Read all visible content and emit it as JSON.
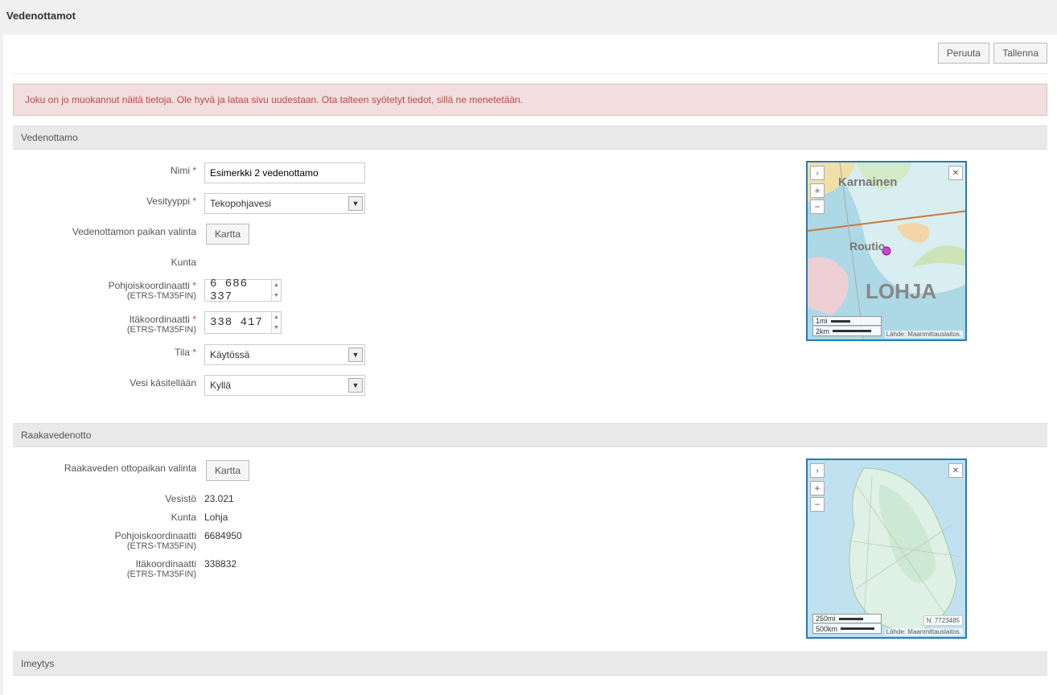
{
  "page": {
    "title": "Vedenottamot"
  },
  "actions": {
    "cancel": "Peruuta",
    "save": "Tallenna"
  },
  "alert": {
    "message": "Joku on jo muokannut näitä tietoja. Ole hyvä ja lataa sivu uudestaan. Ota talteen syötetyt tiedot, sillä ne menetetään."
  },
  "sections": {
    "vedenottamo": {
      "title": "Vedenottamo",
      "labels": {
        "nimi": "Nimi",
        "vesityyppi": "Vesityyppi",
        "paikan_valinta": "Vedenottamon paikan valinta",
        "kunta": "Kunta",
        "pohjois_line1": "Pohjoiskoordinaatti",
        "pohjois_line2": "(ETRS-TM35FIN)",
        "ita_line1": "Itäkoordinaatti",
        "ita_line2": "(ETRS-TM35FIN)",
        "tila": "Tila",
        "kasitellaan": "Vesi käsitellään"
      },
      "values": {
        "nimi": "Esimerkki 2 vedenottamo",
        "vesityyppi": "Tekopohjavesi",
        "kartta_btn": "Kartta",
        "kunta": "",
        "pohjois": "6 686 337",
        "ita": "338 417",
        "tila": "Käytössä",
        "kasitellaan": "Kyllä"
      },
      "map": {
        "label_top": "Karnainen",
        "label_mid": "Routio",
        "label_big": "LOHJA",
        "scale_mi": "1mi",
        "scale_km": "2km",
        "source": "Lähde: Maanmittauslaitos."
      }
    },
    "raaka": {
      "title": "Raakavedenotto",
      "labels": {
        "paikan_valinta": "Raakaveden ottopaikan valinta",
        "vesisto": "Vesistö",
        "kunta": "Kunta",
        "pohjois_line1": "Pohjoiskoordinaatti",
        "pohjois_line2": "(ETRS-TM35FIN)",
        "ita_line1": "Itäkoordinaatti",
        "ita_line2": "(ETRS-TM35FIN)"
      },
      "values": {
        "kartta_btn": "Kartta",
        "vesisto": "23.021",
        "kunta": "Lohja",
        "pohjois": "6684950",
        "ita": "338832"
      },
      "map": {
        "scale_mi": "250mi",
        "scale_km": "500km",
        "coord_tag": "N: 7723485",
        "source": "Lähde: Maanmittauslaitos."
      }
    },
    "imeytys": {
      "title": "Imeytys"
    }
  }
}
